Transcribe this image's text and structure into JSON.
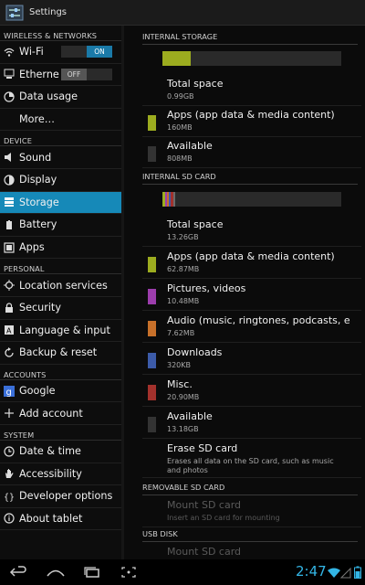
{
  "app": {
    "title": "Settings"
  },
  "sidebar": {
    "sections": [
      {
        "header": "WIRELESS & NETWORKS",
        "items": [
          {
            "label": "Wi-Fi",
            "icon": "wifi-icon",
            "toggle": "ON"
          },
          {
            "label": "Etherne",
            "icon": "ethernet-icon",
            "toggle": "OFF"
          },
          {
            "label": "Data usage",
            "icon": "data-usage-icon"
          },
          {
            "label": "More…",
            "icon": ""
          }
        ]
      },
      {
        "header": "DEVICE",
        "items": [
          {
            "label": "Sound",
            "icon": "speaker-icon"
          },
          {
            "label": "Display",
            "icon": "brightness-icon"
          },
          {
            "label": "Storage",
            "icon": "storage-icon",
            "selected": true
          },
          {
            "label": "Battery",
            "icon": "battery-icon"
          },
          {
            "label": "Apps",
            "icon": "apps-icon"
          }
        ]
      },
      {
        "header": "PERSONAL",
        "items": [
          {
            "label": "Location services",
            "icon": "location-icon"
          },
          {
            "label": "Security",
            "icon": "lock-icon"
          },
          {
            "label": "Language & input",
            "icon": "keyboard-icon"
          },
          {
            "label": "Backup & reset",
            "icon": "backup-icon"
          }
        ]
      },
      {
        "header": "ACCOUNTS",
        "items": [
          {
            "label": "Google",
            "icon": "google-icon"
          },
          {
            "label": "Add account",
            "icon": "plus-icon"
          }
        ]
      },
      {
        "header": "SYSTEM",
        "items": [
          {
            "label": "Date & time",
            "icon": "clock-icon"
          },
          {
            "label": "Accessibility",
            "icon": "hand-icon"
          },
          {
            "label": "Developer options",
            "icon": "braces-icon"
          },
          {
            "label": "About tablet",
            "icon": "info-icon"
          }
        ]
      }
    ]
  },
  "storage": {
    "internal": {
      "header": "INTERNAL STORAGE",
      "usage_fraction": 0.16,
      "rows": [
        {
          "title": "Total space",
          "sub": "0.99GB",
          "color": ""
        },
        {
          "title": "Apps (app data & media content)",
          "sub": "160MB",
          "color": "#9cac1f"
        },
        {
          "title": "Available",
          "sub": "808MB",
          "color": "#333333"
        }
      ]
    },
    "sdcard": {
      "header": "INTERNAL SD CARD",
      "rows": [
        {
          "title": "Total space",
          "sub": "13.26GB",
          "color": ""
        },
        {
          "title": "Apps (app data & media content)",
          "sub": "62.87MB",
          "color": "#9cac1f"
        },
        {
          "title": "Pictures, videos",
          "sub": "10.48MB",
          "color": "#9c3dac"
        },
        {
          "title": "Audio (music, ringtones, podcasts, e",
          "sub": "7.62MB",
          "color": "#c7702a"
        },
        {
          "title": "Downloads",
          "sub": "320KB",
          "color": "#3c5ba9"
        },
        {
          "title": "Misc.",
          "sub": "20.90MB",
          "color": "#a3312c"
        },
        {
          "title": "Available",
          "sub": "13.18GB",
          "color": "#333333"
        },
        {
          "title": "Erase SD card",
          "sub": "Erases all data on the SD card, such as music and photos",
          "color": ""
        }
      ]
    },
    "removable": {
      "header": "REMOVABLE SD CARD",
      "rows": [
        {
          "title": "Mount SD card",
          "sub": "Insert an SD card for mounting",
          "color": "",
          "disabled": true
        }
      ]
    },
    "usb": {
      "header": "USB DISK",
      "rows": [
        {
          "title": "Mount SD card",
          "sub": "",
          "color": "",
          "disabled": true
        }
      ]
    }
  },
  "statusbar": {
    "time": "2:47"
  },
  "colors": {
    "accent": "#33b5e5",
    "selected": "#1689b8",
    "apps_bar": "#9cac1f"
  }
}
